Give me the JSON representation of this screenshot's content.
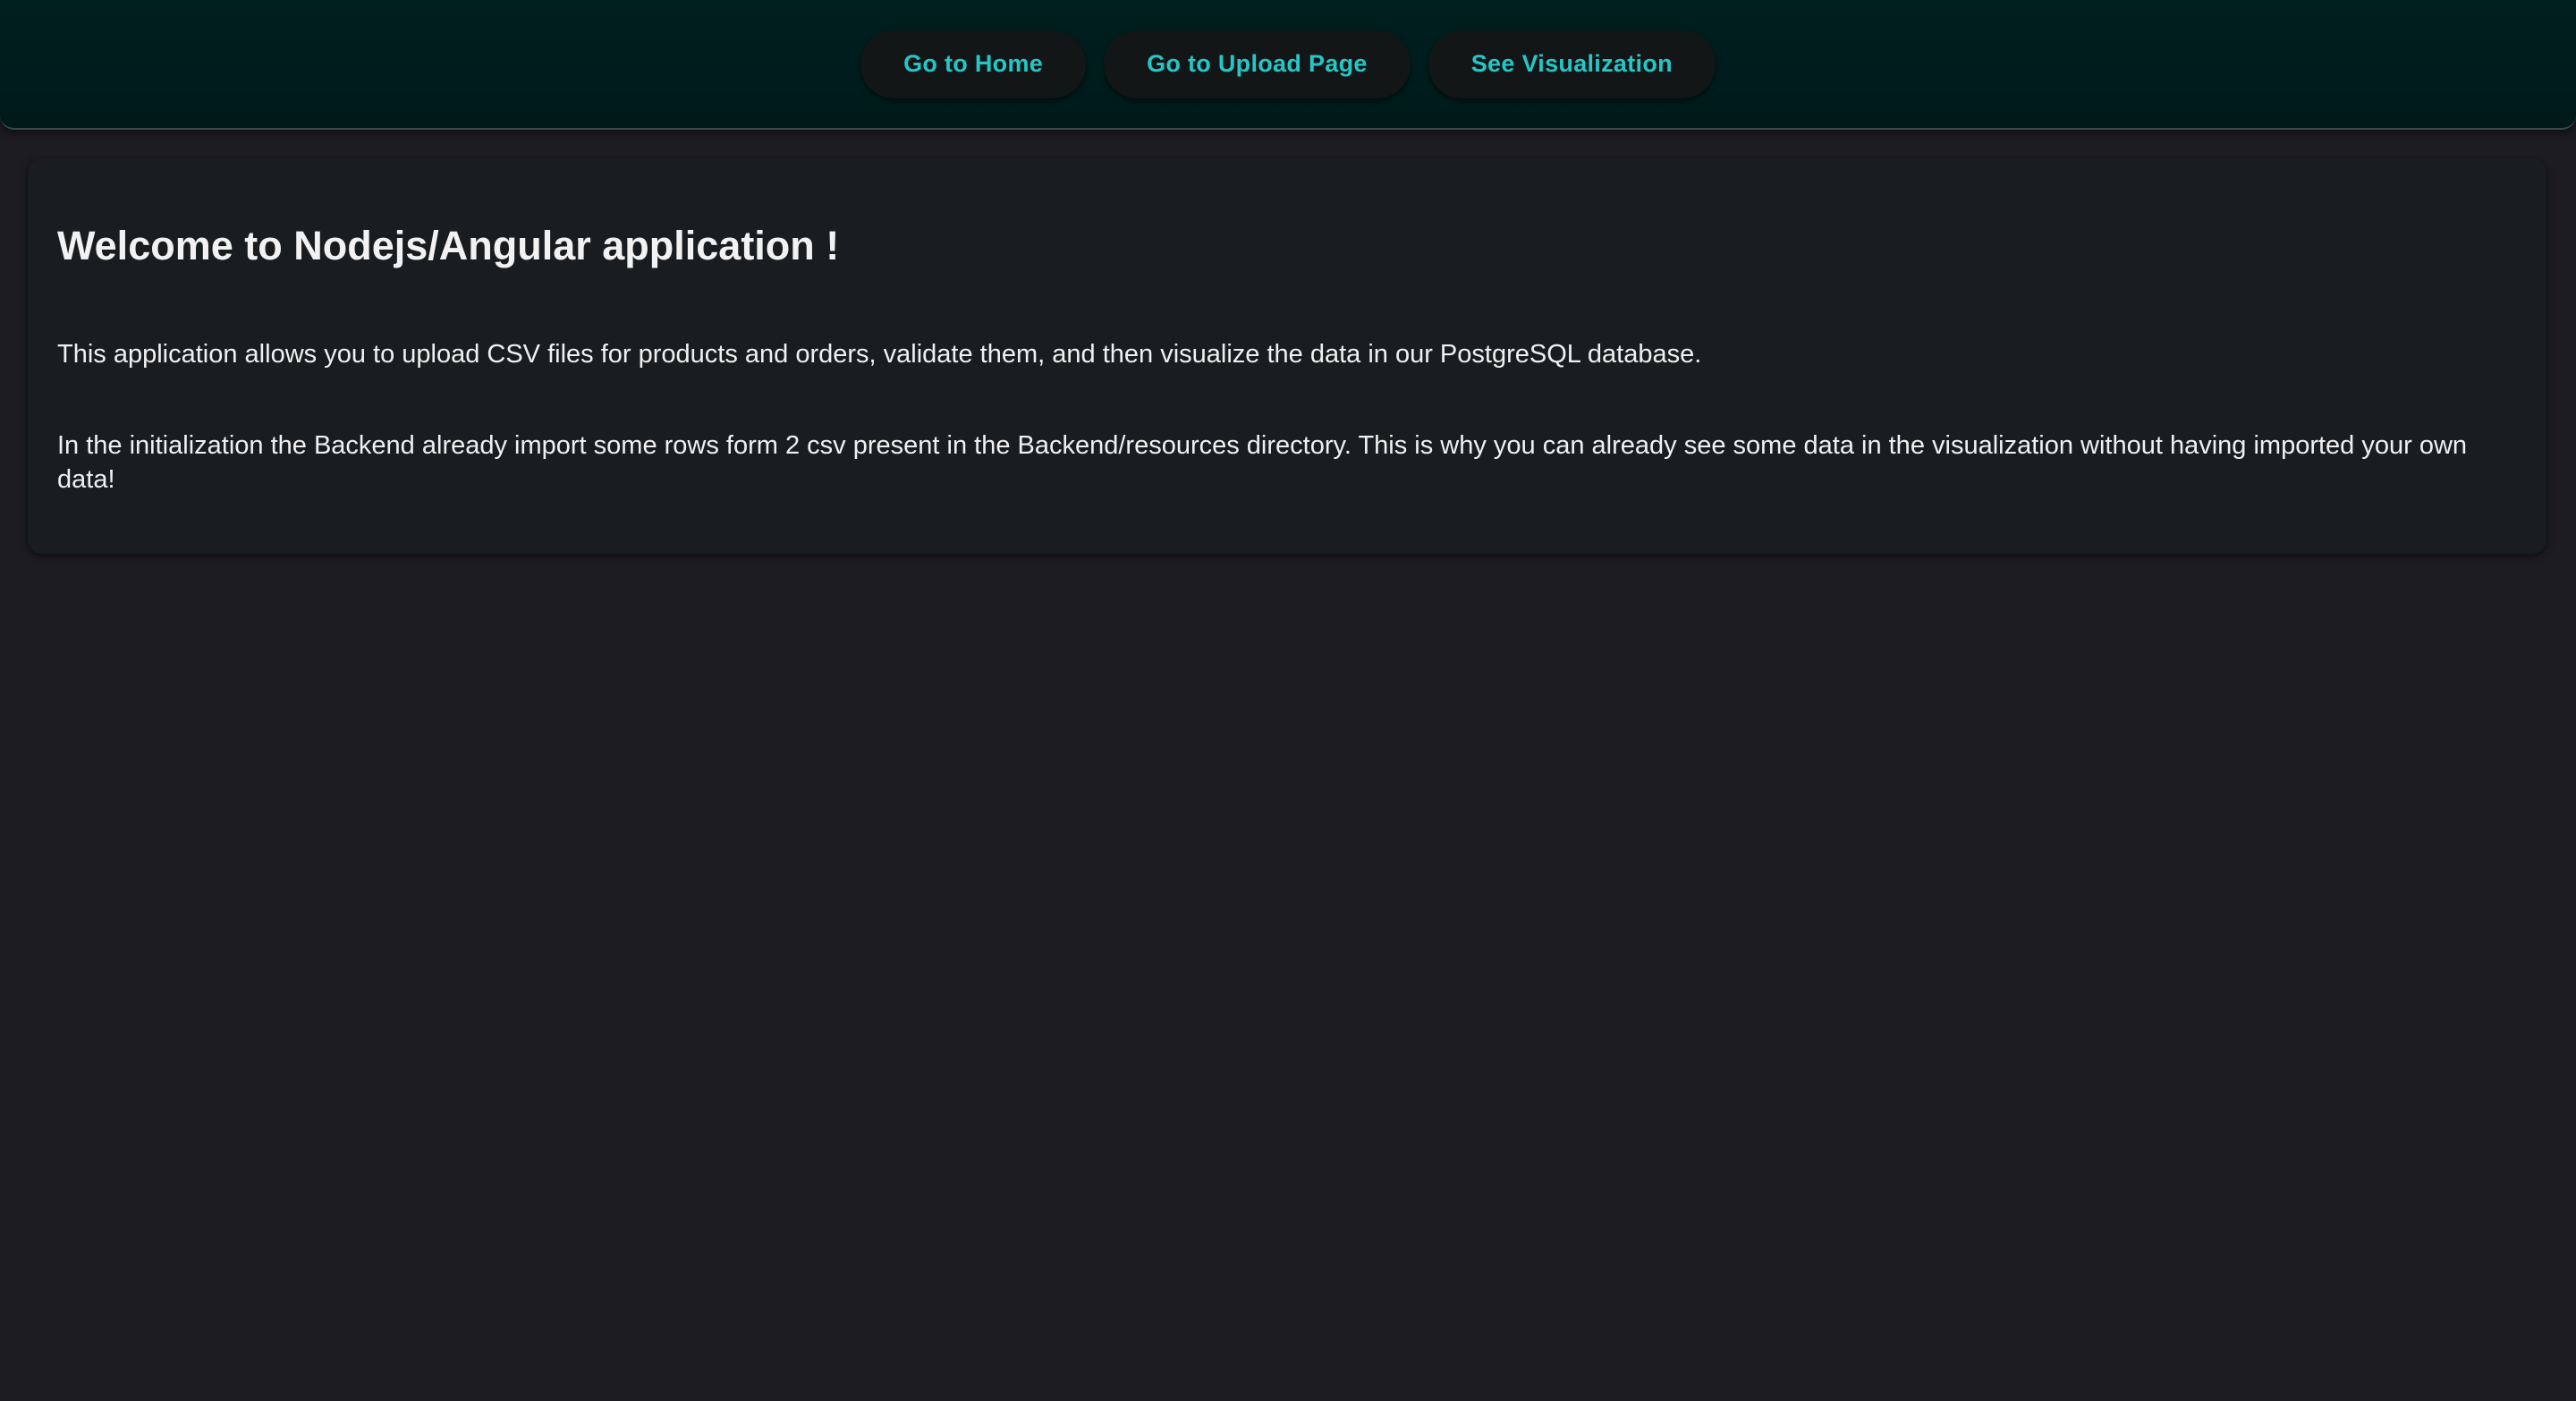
{
  "toolbar": {
    "buttons": [
      {
        "label": "Go to Home"
      },
      {
        "label": "Go to Upload Page"
      },
      {
        "label": "See Visualization"
      }
    ]
  },
  "welcome": {
    "title": "Welcome to Nodejs/Angular application !",
    "paragraph1": "This application allows you to upload CSV files for products and orders, validate them, and then visualize the data in our PostgreSQL database.",
    "paragraph2": "In the initialization the Backend already import some rows form 2 csv present in the Backend/resources directory. This is why you can already see some data in the visualization without having imported your own data!"
  },
  "colors": {
    "background": "#1c1c21",
    "toolbar": "#001f1f",
    "accent": "#26c6c6",
    "card": "#1a1d1f"
  }
}
